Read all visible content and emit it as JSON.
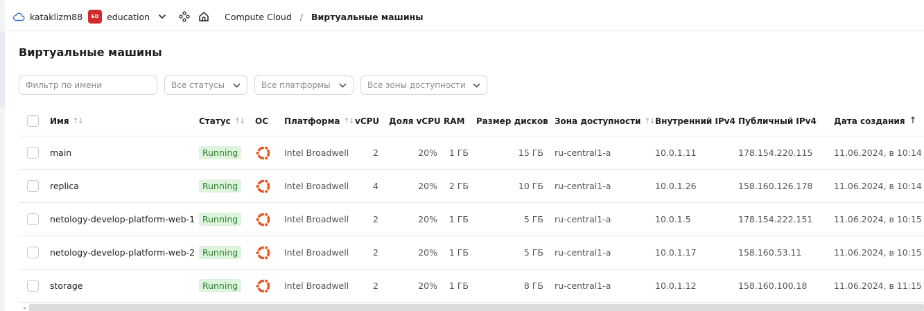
{
  "topbar": {
    "account": "kataklizm88",
    "folder_badge": "ED",
    "folder": "education",
    "service": "Compute Cloud",
    "separator": "/",
    "current": "Виртуальные машины"
  },
  "page_title": "Виртуальные машины",
  "filters": {
    "name_placeholder": "Фильтр по имени",
    "status": "Все статусы",
    "platform": "Все платформы",
    "zone": "Все зоны доступности"
  },
  "columns": {
    "name": "Имя",
    "status": "Статус",
    "os": "ОС",
    "platform": "Платформа",
    "vcpu": "vCPU",
    "share": "Доля vCPU",
    "ram": "RAM",
    "disk": "Размер дисков",
    "zone": "Зона доступности",
    "internal_ip": "Внутренний IPv4",
    "public_ip": "Публичный IPv4",
    "created": "Дата создания"
  },
  "rows": [
    {
      "name": "main",
      "status": "Running",
      "platform": "Intel Broadwell",
      "vcpu": "2",
      "share": "20%",
      "ram": "1 ГБ",
      "disk": "15 ГБ",
      "zone": "ru-central1-a",
      "internal_ip": "10.0.1.11",
      "public_ip": "178.154.220.115",
      "created": "11.06.2024, в 10:14"
    },
    {
      "name": "replica",
      "status": "Running",
      "platform": "Intel Broadwell",
      "vcpu": "4",
      "share": "20%",
      "ram": "2 ГБ",
      "disk": "10 ГБ",
      "zone": "ru-central1-a",
      "internal_ip": "10.0.1.26",
      "public_ip": "158.160.126.178",
      "created": "11.06.2024, в 10:14"
    },
    {
      "name": "netology-develop-platform-web-1",
      "status": "Running",
      "platform": "Intel Broadwell",
      "vcpu": "2",
      "share": "20%",
      "ram": "1 ГБ",
      "disk": "5 ГБ",
      "zone": "ru-central1-a",
      "internal_ip": "10.0.1.5",
      "public_ip": "178.154.222.151",
      "created": "11.06.2024, в 10:15"
    },
    {
      "name": "netology-develop-platform-web-2",
      "status": "Running",
      "platform": "Intel Broadwell",
      "vcpu": "2",
      "share": "20%",
      "ram": "1 ГБ",
      "disk": "5 ГБ",
      "zone": "ru-central1-a",
      "internal_ip": "10.0.1.17",
      "public_ip": "158.160.53.11",
      "created": "11.06.2024, в 10:15"
    },
    {
      "name": "storage",
      "status": "Running",
      "platform": "Intel Broadwell",
      "vcpu": "2",
      "share": "20%",
      "ram": "1 ГБ",
      "disk": "8 ГБ",
      "zone": "ru-central1-a",
      "internal_ip": "10.0.1.12",
      "public_ip": "158.160.100.18",
      "created": "11.06.2024, в 11:15"
    }
  ],
  "icons": {
    "cloud": "cloud-icon",
    "folder_menu": "chevron-down-icon",
    "services": "services-icon",
    "home": "home-icon",
    "os": "ubuntu-icon",
    "sort": "sort-icon",
    "sort_active": "sort-ascending-icon"
  },
  "colors": {
    "accent": "#3a6fd8",
    "badge": "#d22a2a",
    "running_bg": "#ddf3dc",
    "running_text": "#2f7f33",
    "ubuntu": "#e95420"
  }
}
